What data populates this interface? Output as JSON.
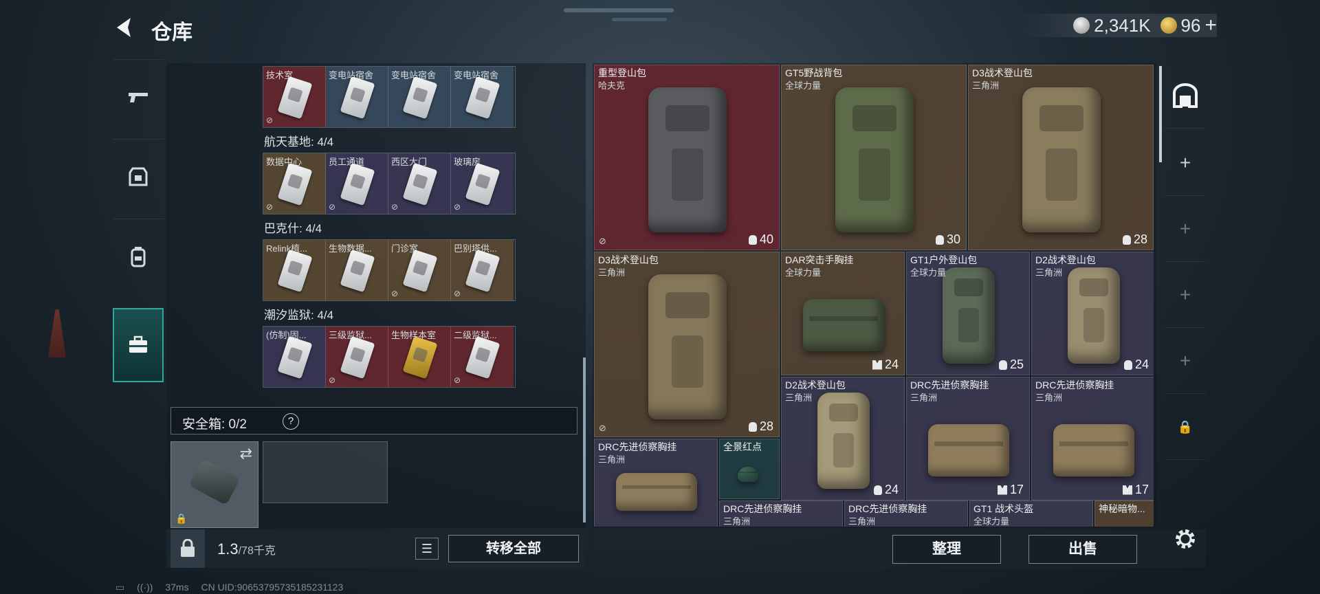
{
  "header": {
    "title": "仓库",
    "currency": [
      {
        "icon": "silver-coin-icon",
        "value": "2,341K"
      },
      {
        "icon": "gold-coin-icon",
        "value": "96"
      }
    ],
    "add_label": "+"
  },
  "side_tabs": [
    {
      "icon": "gun-icon",
      "active": false
    },
    {
      "icon": "armor-icon",
      "active": false
    },
    {
      "icon": "backpack-icon",
      "active": false
    },
    {
      "icon": "briefcase-icon",
      "active": true
    }
  ],
  "key_groups": [
    {
      "label": "",
      "cards": [
        {
          "name": "技术室",
          "rarity": "red"
        },
        {
          "name": "变电站宿舍",
          "rarity": "blue"
        },
        {
          "name": "变电站宿舍",
          "rarity": "blue"
        },
        {
          "name": "变电站宿舍",
          "rarity": "blue"
        }
      ]
    },
    {
      "label": "航天基地: 4/4",
      "cards": [
        {
          "name": "数据中心",
          "rarity": "brown"
        },
        {
          "name": "员工通道",
          "rarity": "purple"
        },
        {
          "name": "西区大门",
          "rarity": "purple"
        },
        {
          "name": "玻璃房",
          "rarity": "purple"
        }
      ]
    },
    {
      "label": "巴克什: 4/4",
      "cards": [
        {
          "name": "Relink植...",
          "rarity": "brown"
        },
        {
          "name": "生物数据...",
          "rarity": "brown"
        },
        {
          "name": "门诊室",
          "rarity": "brown"
        },
        {
          "name": "巴别塔供...",
          "rarity": "brown"
        }
      ]
    },
    {
      "label": "潮汐监狱: 4/4",
      "cards": [
        {
          "name": "(仿制)固...",
          "rarity": "purple"
        },
        {
          "name": "三级监狱...",
          "rarity": "red"
        },
        {
          "name": "生物样本室",
          "rarity": "red"
        },
        {
          "name": "二级监狱...",
          "rarity": "red"
        }
      ]
    }
  ],
  "safe_box": {
    "label": "安全箱: 0/2",
    "help": "?"
  },
  "bag": {
    "weight": "1.3",
    "max_weight": "/78千克",
    "list_label": "☰",
    "transfer_label": "转移全部"
  },
  "status": {
    "battery": "▭",
    "wifi": "((·))",
    "ping": "37ms",
    "uid": "CN UID:90653795735185231123"
  },
  "inventory": [
    {
      "name": "重型登山包",
      "brand": "哈夫克",
      "value": "40",
      "kind": "cap",
      "bg": "red",
      "color": "#5a5c60",
      "shape": "pack",
      "locked": true
    },
    {
      "name": "GT5野战背包",
      "brand": "全球力量",
      "value": "30",
      "kind": "cap",
      "bg": "brown",
      "color": "#5e6b4a",
      "shape": "pack",
      "locked": false
    },
    {
      "name": "D3战术登山包",
      "brand": "三角洲",
      "value": "28",
      "kind": "cap",
      "bg": "brown",
      "color": "#8a7d5e",
      "shape": "pack",
      "locked": false
    },
    {
      "name": "D3战术登山包",
      "brand": "三角洲",
      "value": "28",
      "kind": "cap",
      "bg": "brown",
      "color": "#857759",
      "shape": "pack",
      "locked": true
    },
    {
      "name": "DAR突击手胸挂",
      "brand": "全球力量",
      "value": "24",
      "kind": "vest",
      "bg": "brown",
      "color": "#4e5a44",
      "shape": "rig",
      "locked": false
    },
    {
      "name": "GT1户外登山包",
      "brand": "全球力量",
      "value": "25",
      "kind": "cap",
      "bg": "purple",
      "color": "#5c6a58",
      "shape": "pack",
      "locked": false
    },
    {
      "name": "D2战术登山包",
      "brand": "三角洲",
      "value": "24",
      "kind": "cap",
      "bg": "purple",
      "color": "#9a8e70",
      "shape": "pack",
      "locked": false
    },
    {
      "name": "D2战术登山包",
      "brand": "三角洲",
      "value": "24",
      "kind": "cap",
      "bg": "purple",
      "color": "#a49978",
      "shape": "pack",
      "locked": false
    },
    {
      "name": "DRC先进侦察胸挂",
      "brand": "三角洲",
      "value": "17",
      "kind": "vest",
      "bg": "purple",
      "color": "#8e7c5c",
      "shape": "rig",
      "locked": false
    },
    {
      "name": "DRC先进侦察胸挂",
      "brand": "三角洲",
      "value": "17",
      "kind": "vest",
      "bg": "purple",
      "color": "#8e7c5c",
      "shape": "rig",
      "locked": false
    },
    {
      "name": "DRC先进侦察胸挂",
      "brand": "三角洲",
      "value": "",
      "kind": "vest",
      "bg": "purple",
      "color": "#8e7c5c",
      "shape": "rig",
      "locked": false
    },
    {
      "name": "全景红点",
      "brand": "",
      "value": "",
      "kind": "",
      "bg": "teal",
      "color": "#3d6a5a",
      "shape": "scope",
      "locked": false
    },
    {
      "name": "DRC先进侦察胸挂",
      "brand": "三角洲",
      "value": "",
      "kind": "",
      "bg": "purple",
      "color": "",
      "shape": "none",
      "locked": false
    },
    {
      "name": "DRC先进侦察胸挂",
      "brand": "三角洲",
      "value": "",
      "kind": "",
      "bg": "purple",
      "color": "",
      "shape": "none",
      "locked": false
    },
    {
      "name": "GT1 战术头盔",
      "brand": "全球力量",
      "value": "",
      "kind": "",
      "bg": "purple",
      "color": "",
      "shape": "none",
      "locked": false
    },
    {
      "name": "神秘暗物...",
      "brand": "",
      "value": "",
      "kind": "",
      "bg": "brown",
      "color": "",
      "shape": "none",
      "locked": false
    }
  ],
  "bag_tabs": [
    {
      "icon": "container-icon",
      "label": "⌂",
      "active": true
    },
    {
      "icon": "plus-icon",
      "label": "+",
      "active": false
    },
    {
      "icon": "plus-icon",
      "label": "+",
      "active": false
    },
    {
      "icon": "plus-icon",
      "label": "+",
      "active": false
    },
    {
      "icon": "plus-icon",
      "label": "+",
      "active": false
    },
    {
      "icon": "lock-icon",
      "label": "🔒",
      "active": false
    }
  ],
  "actions": {
    "sort_label": "整理",
    "sell_label": "出售"
  },
  "colors": {
    "accent": "#2fa79a",
    "text": "#e4e8ea",
    "rarity_red": "#6e2630",
    "rarity_purple": "#3e3c56",
    "rarity_brown": "#5c4834"
  }
}
